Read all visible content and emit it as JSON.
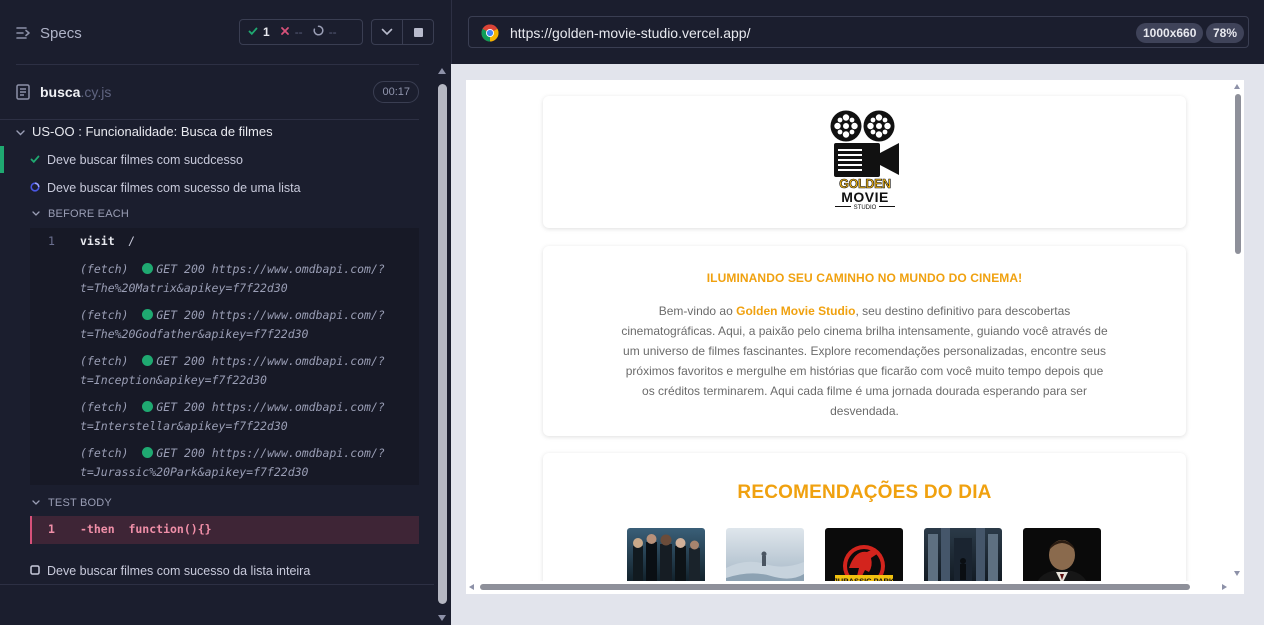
{
  "reporter": {
    "specs_label": "Specs",
    "stats": {
      "passed": "1",
      "failed": "--",
      "pending": "--"
    },
    "file": {
      "name": "busca",
      "ext": ".cy.js",
      "duration": "00:17"
    },
    "suite_title": "US-OO : Funcionalidade: Busca de filmes",
    "tests": [
      "Deve buscar filmes com sucdcesso",
      "Deve buscar filmes com sucesso de uma lista",
      "Deve buscar filmes com sucesso da lista inteira"
    ],
    "before_each_label": "BEFORE EACH",
    "test_body_label": "TEST BODY",
    "commands": [
      {
        "num": "1",
        "name": "visit",
        "message": "/"
      },
      {
        "name": "(fetch)",
        "status": "GET 200",
        "url1": "https://www.omdbapi.com/?",
        "url2": "t=The%20Matrix&apikey=f7f22d30"
      },
      {
        "name": "(fetch)",
        "status": "GET 200",
        "url1": "https://www.omdbapi.com/?",
        "url2": "t=The%20Godfather&apikey=f7f22d30"
      },
      {
        "name": "(fetch)",
        "status": "GET 200",
        "url1": "https://www.omdbapi.com/?",
        "url2": "t=Inception&apikey=f7f22d30"
      },
      {
        "name": "(fetch)",
        "status": "GET 200",
        "url1": "https://www.omdbapi.com/?",
        "url2": "t=Interstellar&apikey=f7f22d30"
      },
      {
        "name": "(fetch)",
        "status": "GET 200",
        "url1": "https://www.omdbapi.com/?",
        "url2": "t=Jurassic%20Park&apikey=f7f22d30"
      }
    ],
    "failing_command": {
      "num": "1",
      "text": "-then  function(){}"
    }
  },
  "aut": {
    "url": "https://golden-movie-studio.vercel.app/",
    "viewport_size": "1000x660",
    "zoom": "78%"
  },
  "site": {
    "logo": {
      "line1": "GOLDEN",
      "line2": "MOVIE",
      "line3": "STUDIO"
    },
    "intro_title": "ILUMINANDO SEU CAMINHO NO MUNDO DO CINEMA!",
    "intro_prefix": "Bem-vindo ao ",
    "intro_brand": "Golden Movie Studio",
    "intro_body": ", seu destino definitivo para descobertas cinematográficas. Aqui, a paixão pelo cinema brilha intensamente, guiando você através de um universo de filmes fascinantes. Explore recomendações personalizadas, encontre seus próximos favoritos e mergulhe em histórias que ficarão com você muito tempo depois que os créditos terminarem. Aqui cada filme é uma jornada dourada esperando para ser desvendada.",
    "recs_title": "RECOMENDAÇÕES DO DIA",
    "posters": [
      "The Matrix",
      "Interstellar",
      "Jurassic Park",
      "Inception",
      "The Godfather"
    ],
    "jurassic_text": "JURASSIC PARK"
  },
  "colors": {
    "accent": "#f0a10f",
    "pass": "#1fa971",
    "fail": "#d7517a"
  }
}
